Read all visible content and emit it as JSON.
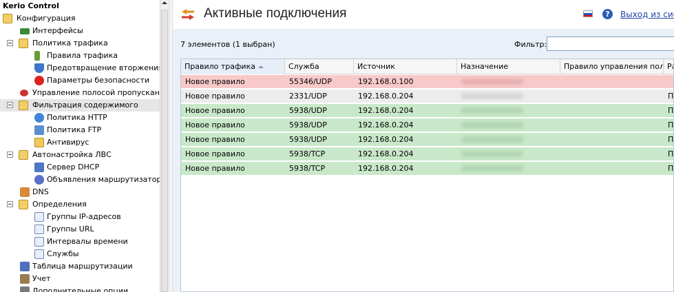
{
  "app_title": "Kerio Control",
  "sidebar": {
    "items": [
      {
        "label": "Конфигурация",
        "icon": "gear-folder-icon"
      },
      {
        "label": "Интерфейсы",
        "icon": "network-card-icon"
      },
      {
        "label": "Политика трафика",
        "icon": "folder-icon"
      },
      {
        "label": "Правила трафика",
        "icon": "traffic-rules-icon"
      },
      {
        "label": "Предотвращение вторжения",
        "icon": "shield-icon"
      },
      {
        "label": "Параметры безопасности",
        "icon": "stop-sign-icon"
      },
      {
        "label": "Управление полосой пропускания и",
        "icon": "bandwidth-icon"
      },
      {
        "label": "Фильтрация содержимого",
        "icon": "folder-icon"
      },
      {
        "label": "Политика HTTP",
        "icon": "globe-icon"
      },
      {
        "label": "Политика FTP",
        "icon": "ftp-icon"
      },
      {
        "label": "Антивирус",
        "icon": "antivirus-icon"
      },
      {
        "label": "Автонастройка ЛВС",
        "icon": "folder-icon"
      },
      {
        "label": "Сервер DHCP",
        "icon": "dhcp-server-icon"
      },
      {
        "label": "Объявления маршрутизатора IP",
        "icon": "router-icon"
      },
      {
        "label": "DNS",
        "icon": "dns-icon"
      },
      {
        "label": "Определения",
        "icon": "folder-icon"
      },
      {
        "label": "Группы IP-адресов",
        "icon": "ip-groups-icon"
      },
      {
        "label": "Группы URL",
        "icon": "url-groups-icon"
      },
      {
        "label": "Интервалы времени",
        "icon": "clock-icon"
      },
      {
        "label": "Службы",
        "icon": "services-icon"
      },
      {
        "label": "Таблица маршрутизации",
        "icon": "routing-table-icon"
      },
      {
        "label": "Учет",
        "icon": "accounting-icon"
      },
      {
        "label": "Дополнительные опции",
        "icon": "options-icon"
      }
    ]
  },
  "header": {
    "title": "Активные подключения",
    "logout": "Выход из систе"
  },
  "toolbar": {
    "count_text": "7 элементов (1 выбран)",
    "filter_label": "Фильтр:"
  },
  "table": {
    "columns": [
      "Правило трафика",
      "Служба",
      "Источник",
      "Назначение",
      "Правило управления пол…",
      "Ра"
    ],
    "rows": [
      {
        "rule": "Новое правило",
        "service": "55346/UDP",
        "source": "192.168.0.100",
        "dest": "",
        "bw": "",
        "extra": "",
        "status": "selected"
      },
      {
        "rule": "Новое правило",
        "service": "2331/UDP",
        "source": "192.168.0.204",
        "dest": "",
        "bw": "",
        "extra": "По",
        "status": "plain"
      },
      {
        "rule": "Новое правило",
        "service": "5938/UDP",
        "source": "192.168.0.204",
        "dest": "",
        "bw": "",
        "extra": "По",
        "status": "allowed"
      },
      {
        "rule": "Новое правило",
        "service": "5938/UDP",
        "source": "192.168.0.204",
        "dest": "",
        "bw": "",
        "extra": "По",
        "status": "allowed"
      },
      {
        "rule": "Новое правило",
        "service": "5938/UDP",
        "source": "192.168.0.204",
        "dest": "",
        "bw": "",
        "extra": "По",
        "status": "allowed"
      },
      {
        "rule": "Новое правило",
        "service": "5938/TCP",
        "source": "192.168.0.204",
        "dest": "",
        "bw": "",
        "extra": "По",
        "status": "allowed"
      },
      {
        "rule": "Новое правило",
        "service": "5938/TCP",
        "source": "192.168.0.204",
        "dest": "",
        "bw": "",
        "extra": "По",
        "status": "allowed"
      }
    ]
  },
  "colors": {
    "selected_row": "#f8c9c9",
    "allowed_row": "#c9e8c9",
    "plain_row": "#ececec",
    "link": "#2547a7"
  }
}
